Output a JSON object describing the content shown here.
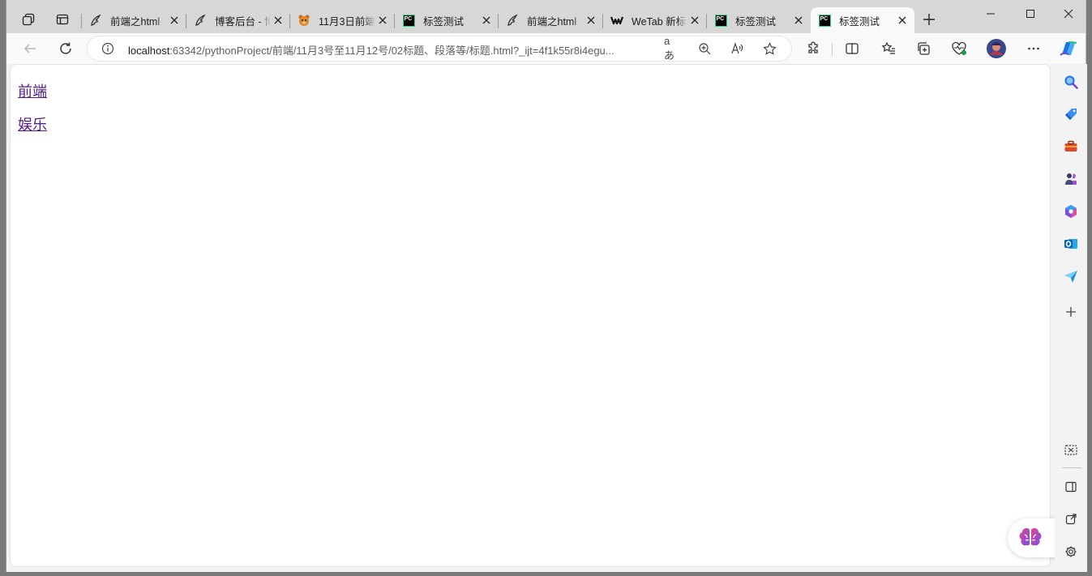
{
  "tabs": [
    {
      "title": "前端之html",
      "fav": "feather"
    },
    {
      "title": "博客后台 - 博",
      "fav": "feather"
    },
    {
      "title": "11月3日前端",
      "fav": "bear"
    },
    {
      "title": "标签测试",
      "fav": "pycharm"
    },
    {
      "title": "前端之html",
      "fav": "feather"
    },
    {
      "title": "WeTab 新标",
      "fav": "wetab"
    },
    {
      "title": "标签测试",
      "fav": "pycharm"
    },
    {
      "title": "标签测试",
      "fav": "pycharm",
      "active": true
    }
  ],
  "pycharm_badge": "PC",
  "address": {
    "host": "localhost",
    "rest": ":63342/pythonProject/前端/11月3号至11月12号/02标题、段落等/标题.html?_ijt=4f1k55r8i4egu..."
  },
  "read_aloud_label": "aあ",
  "links": [
    "前端",
    "娱乐"
  ],
  "colors": {
    "visited_link": "#551a8b",
    "tabstrip": "#d7d7d7",
    "toolbar": "#f9f9f9",
    "edge_blue": "#1a73e8"
  }
}
